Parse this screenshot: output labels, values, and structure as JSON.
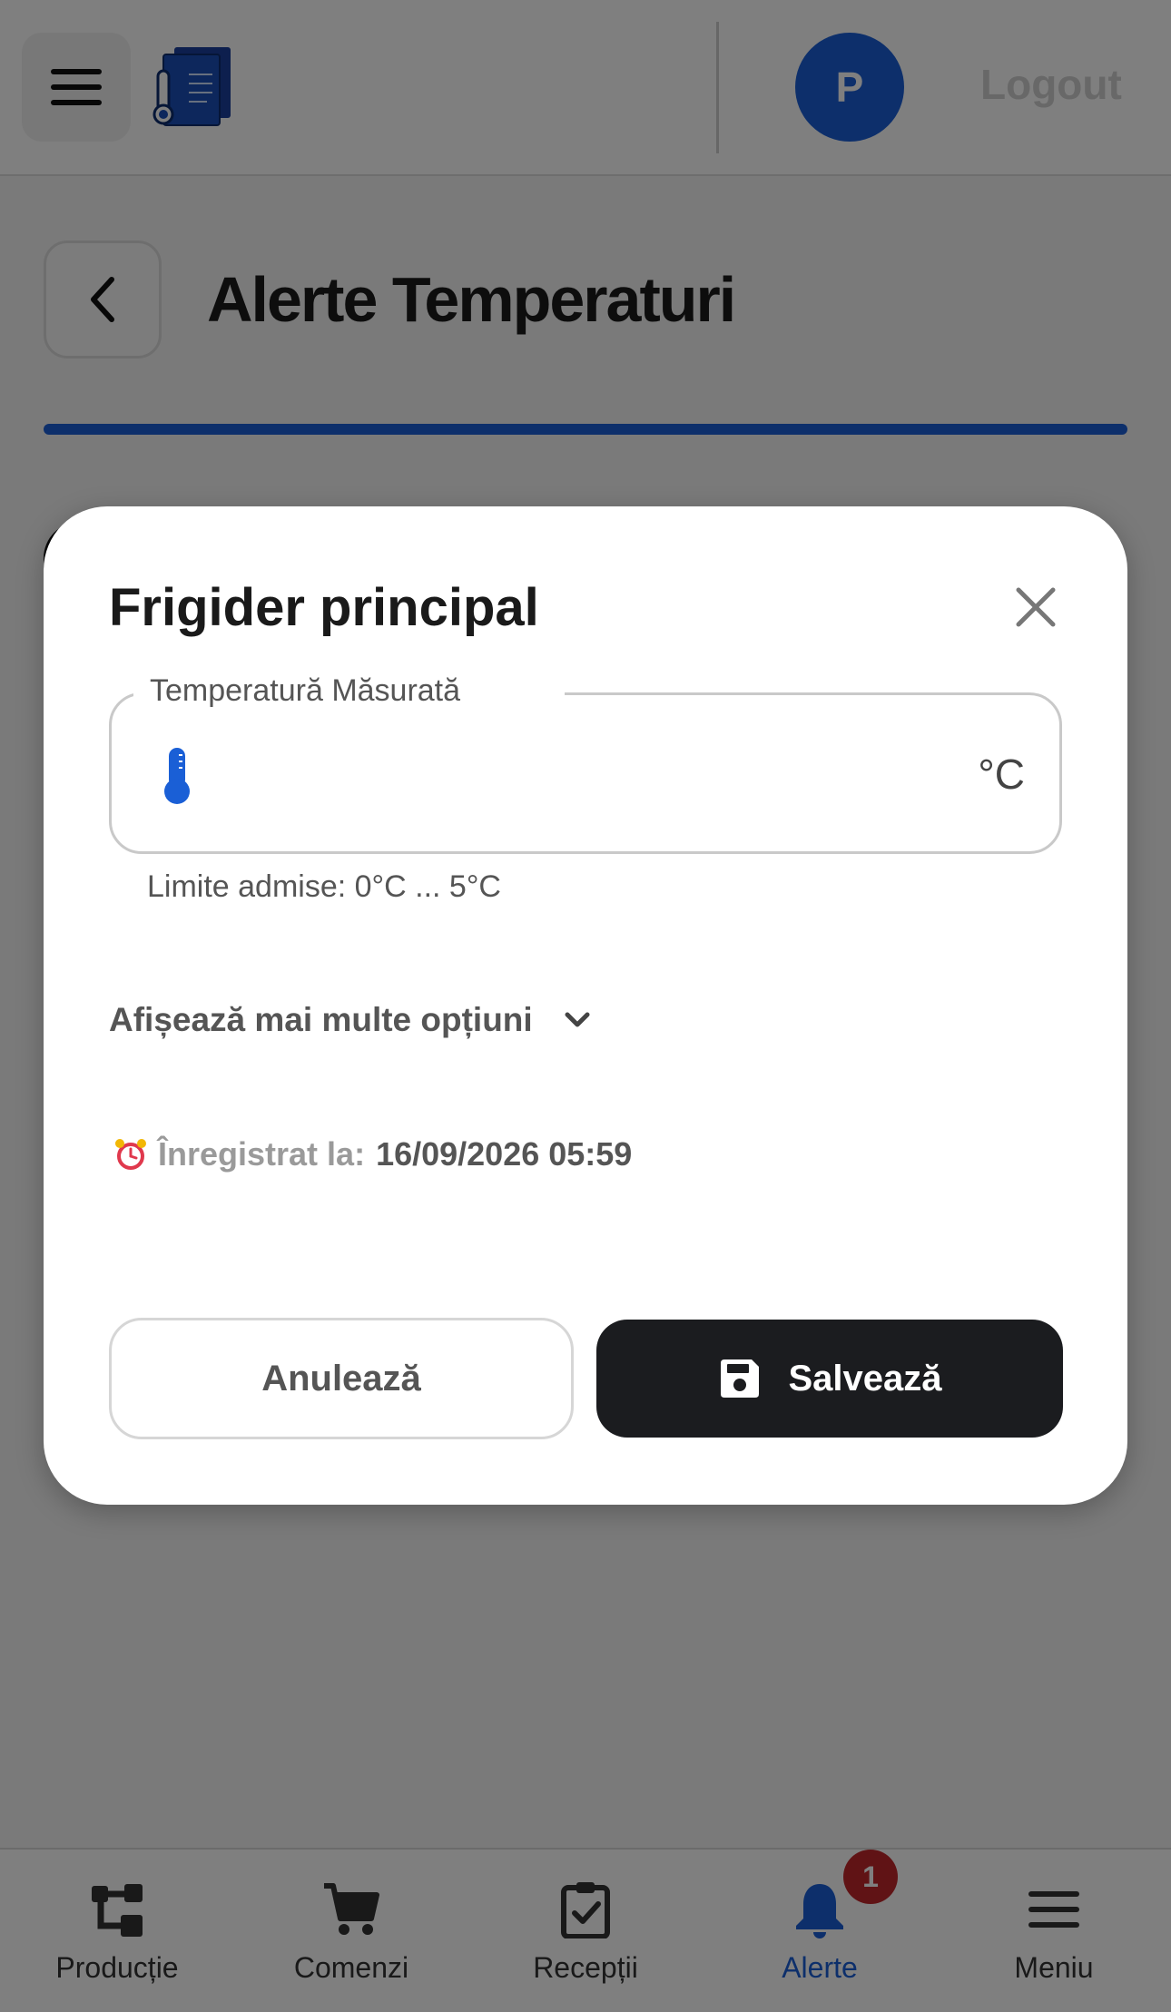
{
  "header": {
    "avatar_initial": "P",
    "logout_label": "Logout"
  },
  "page": {
    "title": "Alerte Temperaturi"
  },
  "modal": {
    "title": "Frigider principal",
    "field_label": "Temperatură Măsurată",
    "field_value": "",
    "unit": "°C",
    "limits": "Limite admise: 0°C ... 5°C",
    "more_options": "Afișează mai multe opțiuni",
    "recorded_label": "Înregistrat la:",
    "recorded_value": "16/09/2026 05:59",
    "cancel_label": "Anulează",
    "save_label": "Salvează"
  },
  "bottom_nav": {
    "items": [
      {
        "label": "Producție",
        "icon": "production-icon"
      },
      {
        "label": "Comenzi",
        "icon": "cart-icon"
      },
      {
        "label": "Recepții",
        "icon": "clipboard-check-icon"
      },
      {
        "label": "Alerte",
        "icon": "bell-icon",
        "active": true,
        "badge": "1"
      },
      {
        "label": "Meniu",
        "icon": "menu-icon"
      }
    ]
  },
  "colors": {
    "accent": "#1a5fd6",
    "badge": "#c0262b",
    "primary_button": "#1b1c1f"
  }
}
